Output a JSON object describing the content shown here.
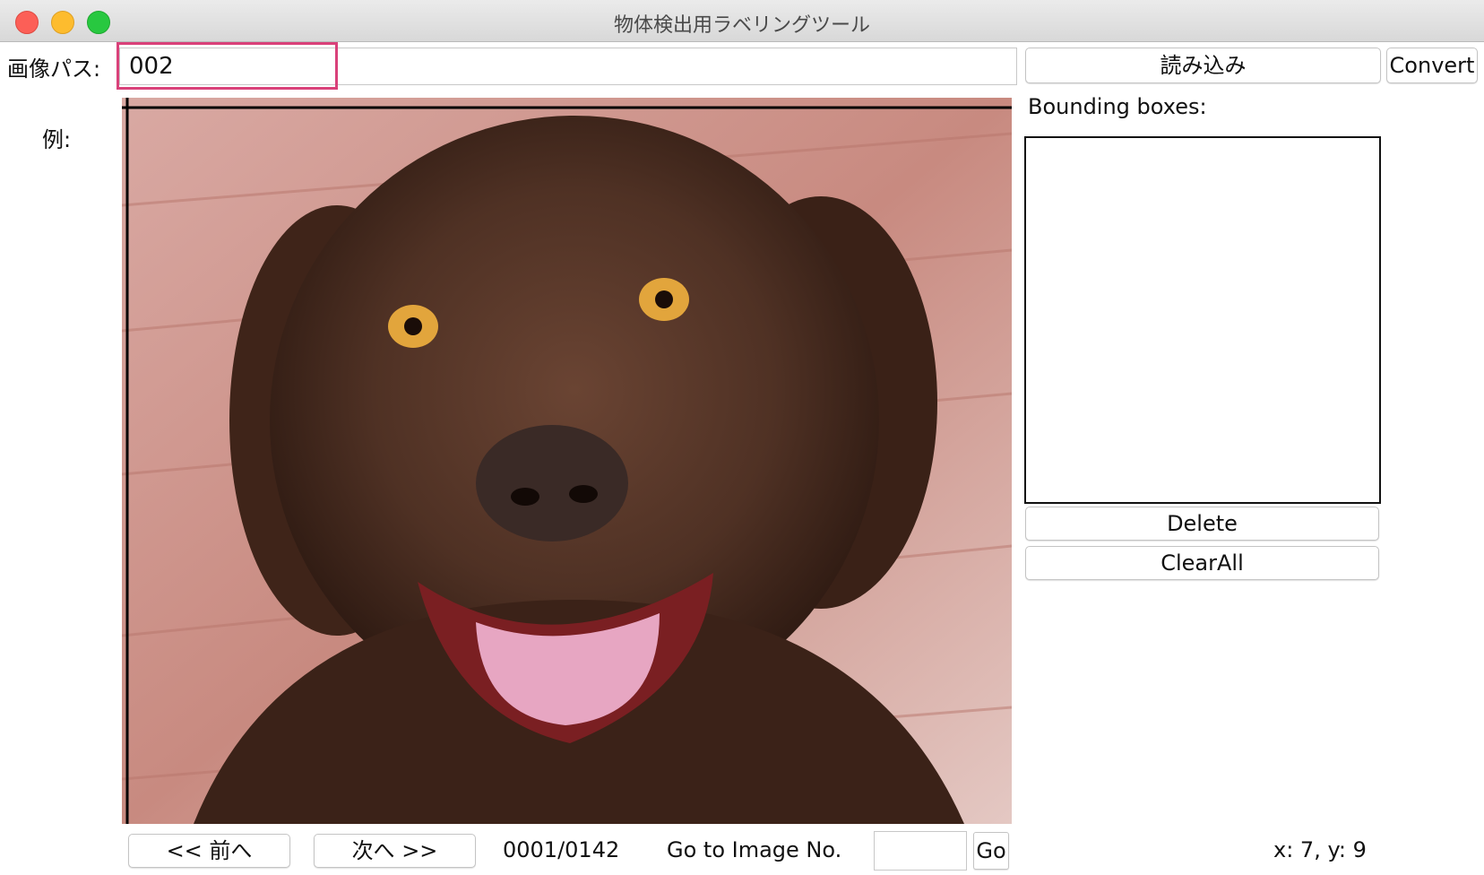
{
  "window": {
    "title": "物体検出用ラベリングツール"
  },
  "toolbar": {
    "path_label": "画像パス:",
    "path_value": "002",
    "load_button": "読み込み",
    "convert_button": "Convert"
  },
  "example_label": "例:",
  "image": {
    "description": "chocolate labrador retriever face"
  },
  "bbox_panel": {
    "title": "Bounding boxes:",
    "items": [],
    "delete_button": "Delete",
    "clear_button": "ClearAll"
  },
  "navigation": {
    "prev_button": "<< 前へ",
    "next_button": "次へ >>",
    "counter": "0001/0142",
    "goto_label": "Go to Image No.",
    "goto_value": "",
    "go_button": "Go"
  },
  "status": {
    "coords": "x: 7, y: 9"
  }
}
